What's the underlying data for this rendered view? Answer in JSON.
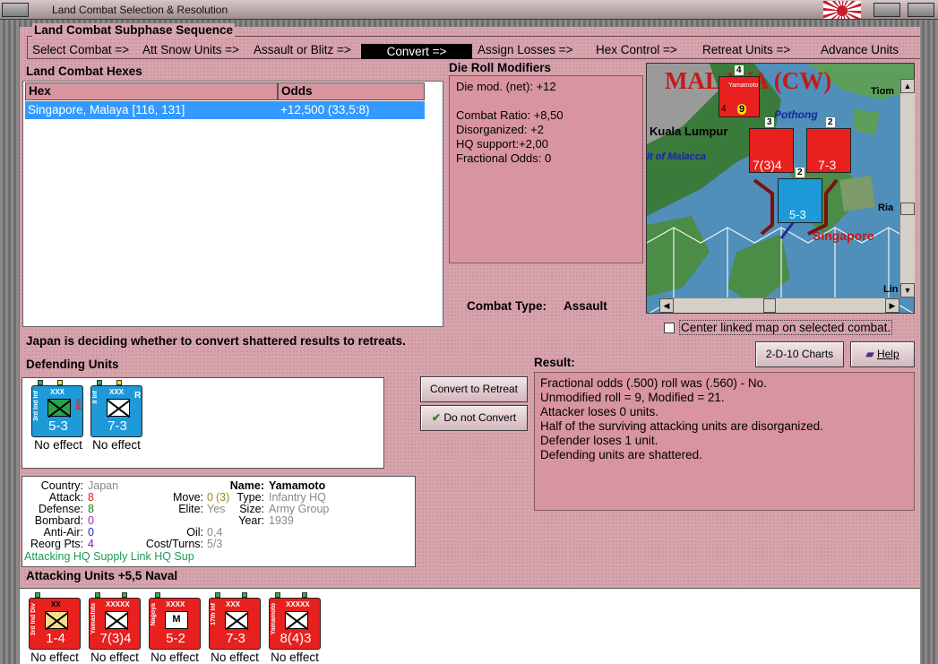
{
  "window": {
    "title": "Land Combat Selection & Resolution"
  },
  "sequence": {
    "header": "Land Combat Subphase Sequence",
    "steps": [
      "Select Combat =>",
      "Att Snow Units =>",
      "Assault or Blitz =>",
      "Convert =>",
      "Assign Losses =>",
      "Hex Control =>",
      "Retreat Units =>",
      "Advance Units"
    ],
    "current": "Convert =>"
  },
  "hexes": {
    "header": "Land Combat Hexes",
    "col_hex": "Hex",
    "col_odds": "Odds",
    "row_hex": "Singapore, Malaya [116, 131]",
    "row_odds": "+12,500 (33,5:8)"
  },
  "drm": {
    "header": "Die Roll Modifiers",
    "lines": [
      "Die mod. (net): +12",
      "",
      "Combat Ratio: +8,50",
      "Disorganized: +2",
      "HQ support:+2,00",
      "Fractional Odds: 0"
    ]
  },
  "combat_type": {
    "label": "Combat Type:",
    "value": "Assault"
  },
  "map": {
    "title": "MALAYA (CW)",
    "cities": [
      "Kuala Lumpur",
      "Pothong",
      "Singapore",
      "Tiom",
      "Ria",
      "Lin"
    ],
    "strait": "it of Malacca",
    "stack_counts": [
      "4",
      "3",
      "2",
      "2"
    ],
    "units": [
      "7(3)4",
      "7-3",
      "5-3"
    ],
    "top_unit_value": "9",
    "hq_label": "Yamamoto",
    "hq_value": "4"
  },
  "center_link": {
    "label": "Center linked map on selected combat.",
    "checked": false
  },
  "status": "Japan is deciding whether to convert shattered results to retreats.",
  "buttons": {
    "charts": "2-D-10 Charts",
    "help": "Help",
    "convert": "Convert to Retreat",
    "no_convert": "Do not Convert"
  },
  "defending": {
    "header": "Defending Units",
    "units": [
      {
        "name": "3rd Ind Inf",
        "size": "XXX",
        "value": "5-3",
        "effect": "No effect",
        "color": "#1e9ad8",
        "badge": "Ind"
      },
      {
        "name": "II Inf",
        "size": "XXX",
        "value": "7-3",
        "effect": "No effect",
        "color": "#1e9ad8",
        "badge": "R"
      }
    ]
  },
  "info": {
    "country_l": "Country:",
    "country": "Japan",
    "attack_l": "Attack:",
    "attack": "8",
    "defense_l": "Defense:",
    "defense": "8",
    "bombard_l": "Bombard:",
    "bombard": "0",
    "aa_l": "Anti-Air:",
    "aa": "0",
    "reorg_l": "Reorg Pts:",
    "reorg": "4",
    "move_l": "Move:",
    "move": "0",
    "move2": "(3)",
    "elite_l": "Elite:",
    "elite": "Yes",
    "oil_l": "Oil:",
    "oil": "0,4",
    "cost_l": "Cost/Turns:",
    "cost": "5/3",
    "name_l": "Name:",
    "name": "Yamamoto",
    "type_l": "Type:",
    "type": "Infantry HQ",
    "size_l": "Size:",
    "size": "Army Group",
    "year_l": "Year:",
    "year": "1939",
    "footer": "Attacking HQ Supply Link HQ Sup"
  },
  "result": {
    "header": "Result:",
    "lines": [
      "Fractional odds (.500) roll was (.560)  - No.",
      "Unmodified roll = 9, Modified = 21.",
      "Attacker loses 0 units.",
      "Half of the surviving attacking units are disorganized.",
      "Defender loses 1 unit.",
      "Defending units are shattered."
    ]
  },
  "attacking": {
    "header": "Attacking Units +5,5 Naval",
    "units": [
      {
        "name": "3rd Ind Div",
        "size": "XX",
        "value": "1-4",
        "effect": "No effect",
        "sym": "yellow"
      },
      {
        "name": "Yamashita",
        "size": "XXXXX",
        "value": "7(3)4",
        "effect": "No effect",
        "sym": "x"
      },
      {
        "name": "Nagoya",
        "size": "XXXX",
        "value": "5-2",
        "effect": "No effect",
        "sym": "m"
      },
      {
        "name": "17th Inf",
        "size": "XXX",
        "value": "7-3",
        "effect": "No effect",
        "sym": "x"
      },
      {
        "name": "Yamamoto",
        "size": "XXXXX",
        "value": "8(4)3",
        "effect": "No effect",
        "sym": "x"
      }
    ]
  },
  "colors": {
    "panel": "#d7a4ad",
    "box": "#d8949f",
    "highlight": "#3399ff",
    "unit_red": "#e8201e",
    "unit_blue": "#1e9ad8"
  },
  "icons": [
    "window-menu-icon",
    "japan-flag-icon",
    "checkmark-icon",
    "help-book-icon"
  ]
}
